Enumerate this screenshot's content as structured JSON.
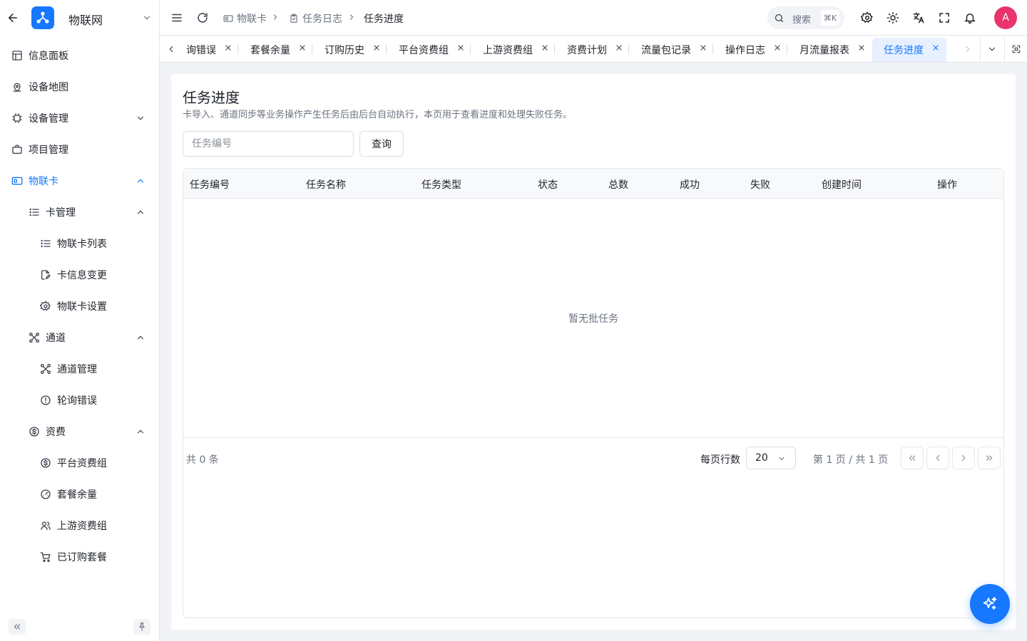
{
  "app": {
    "name": "物联网"
  },
  "sidebar": {
    "items": [
      {
        "label": "信息面板",
        "icon": "dashboard-icon"
      },
      {
        "label": "设备地图",
        "icon": "map-icon"
      },
      {
        "label": "设备管理",
        "icon": "chip-icon",
        "expanded": false
      },
      {
        "label": "项目管理",
        "icon": "briefcase-icon"
      },
      {
        "label": "物联卡",
        "icon": "sim-card-icon",
        "expanded": true,
        "active": true
      },
      {
        "label": "卡管理",
        "icon": "list-icon",
        "expanded": true
      },
      {
        "label": "物联卡列表",
        "icon": "list-icon"
      },
      {
        "label": "卡信息变更",
        "icon": "file-edit-icon"
      },
      {
        "label": "物联卡设置",
        "icon": "gear-icon"
      },
      {
        "label": "通道",
        "icon": "network-icon",
        "expanded": true
      },
      {
        "label": "通道管理",
        "icon": "network-icon"
      },
      {
        "label": "轮询错误",
        "icon": "alert-circle-icon"
      },
      {
        "label": "资费",
        "icon": "dollar-circle-icon",
        "expanded": true
      },
      {
        "label": "平台资费组",
        "icon": "dollar-circle-icon"
      },
      {
        "label": "套餐余量",
        "icon": "gauge-icon"
      },
      {
        "label": "上游资费组",
        "icon": "users-icon"
      },
      {
        "label": "已订购套餐",
        "icon": "cart-icon"
      }
    ]
  },
  "header": {
    "breadcrumbs": [
      "物联卡",
      "任务日志",
      "任务进度"
    ],
    "search_label": "搜索",
    "search_shortcut": "⌘K",
    "avatar_initial": "A"
  },
  "tabs": [
    {
      "label": "询错误",
      "active": false
    },
    {
      "label": "套餐余量",
      "active": false
    },
    {
      "label": "订购历史",
      "active": false
    },
    {
      "label": "平台资费组",
      "active": false
    },
    {
      "label": "上游资费组",
      "active": false
    },
    {
      "label": "资费计划",
      "active": false
    },
    {
      "label": "流量包记录",
      "active": false
    },
    {
      "label": "操作日志",
      "active": false
    },
    {
      "label": "月流量报表",
      "active": false
    },
    {
      "label": "任务进度",
      "active": true
    }
  ],
  "page": {
    "title": "任务进度",
    "description": "卡导入、通道同步等业务操作产生任务后由后台自动执行，本页用于查看进度和处理失败任务。",
    "task_input_placeholder": "任务编号",
    "query_button": "查询"
  },
  "table": {
    "columns": [
      "任务编号",
      "任务名称",
      "任务类型",
      "状态",
      "总数",
      "成功",
      "失败",
      "创建时间",
      "操作"
    ],
    "rows": [],
    "empty_text": "暂无批任务"
  },
  "pagination": {
    "total_text": "共 0 条",
    "rows_per_page_label": "每页行数",
    "rows_per_page": "20",
    "page_info": "第 1 页 / 共 1 页"
  },
  "colors": {
    "primary": "#1677ff",
    "avatar": "#e8336d"
  }
}
